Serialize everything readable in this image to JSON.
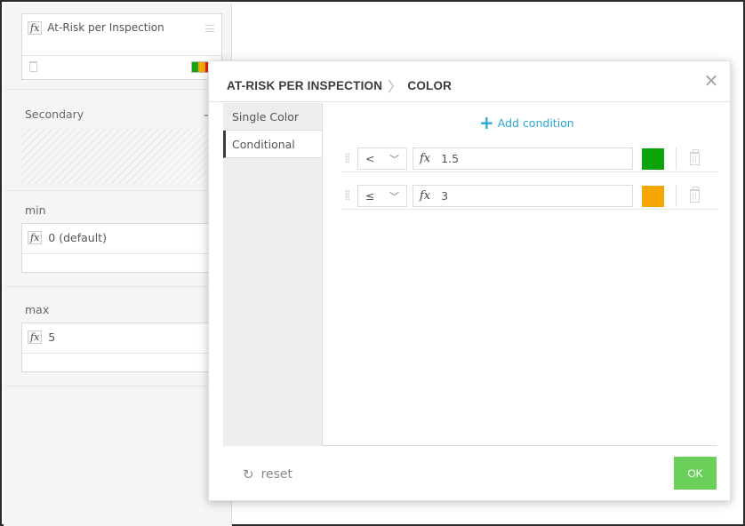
{
  "left_panel": {
    "measure": {
      "fx": "fx",
      "title": "At-Risk per Inspection",
      "swatch_colors": [
        "#1aa31a",
        "#f2a900",
        "#e02020"
      ]
    },
    "secondary_label": "Secondary",
    "secondary_add": "+",
    "min": {
      "label": "min",
      "fx": "fx",
      "value": "0 (default)"
    },
    "max": {
      "label": "max",
      "fx": "fx",
      "value": "5"
    }
  },
  "modal": {
    "crumb_parent": "AT-RISK PER INSPECTION",
    "crumb_current": "COLOR",
    "close": "×",
    "tabs": [
      {
        "label": "Single Color"
      },
      {
        "label": "Conditional"
      }
    ],
    "add_condition": "Add condition",
    "add_condition_plus": "+",
    "conditions": [
      {
        "operator": "<",
        "fx": "fx",
        "value": "1.5",
        "color": "#0aa30a"
      },
      {
        "operator": "≤",
        "fx": "fx",
        "value": "3",
        "color": "#f5a600"
      }
    ],
    "reset_icon": "↻",
    "reset_label": "reset",
    "ok_label": "OK"
  }
}
